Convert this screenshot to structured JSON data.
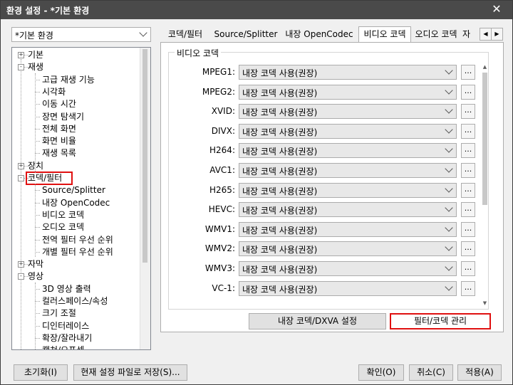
{
  "window": {
    "title": "환경 설정 - *기본 환경",
    "close_label": "✕"
  },
  "profile": {
    "selected": "*기본 환경"
  },
  "tree": [
    {
      "label": "기본",
      "level": 0,
      "expander": "+"
    },
    {
      "label": "재생",
      "level": 0,
      "expander": "-"
    },
    {
      "label": "고급 재생 기능",
      "level": 1
    },
    {
      "label": "시각화",
      "level": 1
    },
    {
      "label": "이동 시간",
      "level": 1
    },
    {
      "label": "장면 탐색기",
      "level": 1
    },
    {
      "label": "전체 화면",
      "level": 1
    },
    {
      "label": "화면 비율",
      "level": 1
    },
    {
      "label": "재생 목록",
      "level": 1
    },
    {
      "label": "장치",
      "level": 0,
      "expander": "+"
    },
    {
      "label": "코덱/필터",
      "level": 0,
      "expander": "-",
      "highlighted": true
    },
    {
      "label": "Source/Splitter",
      "level": 1
    },
    {
      "label": "내장 OpenCodec",
      "level": 1
    },
    {
      "label": "비디오 코덱",
      "level": 1
    },
    {
      "label": "오디오 코덱",
      "level": 1
    },
    {
      "label": "전역 필터 우선 순위",
      "level": 1
    },
    {
      "label": "개별 필터 우선 순위",
      "level": 1
    },
    {
      "label": "자막",
      "level": 0,
      "expander": "+"
    },
    {
      "label": "영상",
      "level": 0,
      "expander": "-"
    },
    {
      "label": "3D 영상 출력",
      "level": 1
    },
    {
      "label": "컬러스페이스/속성",
      "level": 1
    },
    {
      "label": "크기 조절",
      "level": 1
    },
    {
      "label": "디인터레이스",
      "level": 1
    },
    {
      "label": "확장/잘라내기",
      "level": 1
    },
    {
      "label": "캡쳐/오프셋",
      "level": 1
    }
  ],
  "tabs": [
    {
      "label": "코덱/필터"
    },
    {
      "label": "Source/Splitter"
    },
    {
      "label": "내장 OpenCodec"
    },
    {
      "label": "비디오 코덱",
      "active": true
    },
    {
      "label": "오디오 코덱"
    },
    {
      "label": "자"
    }
  ],
  "tab_arrows": {
    "left": "◀",
    "right": "▶"
  },
  "group": {
    "title": "비디오 코덱"
  },
  "codec_rows": [
    {
      "label": "MPEG1:",
      "value": "내장 코덱 사용(권장)"
    },
    {
      "label": "MPEG2:",
      "value": "내장 코덱 사용(권장)"
    },
    {
      "label": "XVID:",
      "value": "내장 코덱 사용(권장)"
    },
    {
      "label": "DIVX:",
      "value": "내장 코덱 사용(권장)"
    },
    {
      "label": "H264:",
      "value": "내장 코덱 사용(권장)"
    },
    {
      "label": "AVC1:",
      "value": "내장 코덱 사용(권장)"
    },
    {
      "label": "H265:",
      "value": "내장 코덱 사용(권장)"
    },
    {
      "label": "HEVC:",
      "value": "내장 코덱 사용(권장)"
    },
    {
      "label": "WMV1:",
      "value": "내장 코덱 사용(권장)"
    },
    {
      "label": "WMV2:",
      "value": "내장 코덱 사용(권장)"
    },
    {
      "label": "WMV3:",
      "value": "내장 코덱 사용(권장)"
    },
    {
      "label": "VC-1:",
      "value": "내장 코덱 사용(권장)"
    }
  ],
  "dots_label": "...",
  "panel_buttons": {
    "dxva": "내장 코덱/DXVA 설정",
    "filter_manage": "필터/코덱 관리"
  },
  "footer": {
    "reset": "초기화(I)",
    "save_preset": "현재 설정 파일로 저장(S)...",
    "ok": "확인(O)",
    "cancel": "취소(C)",
    "apply": "적용(A)"
  },
  "colors": {
    "titlebar": "#4a4a4a",
    "highlight_border": "#e01010"
  }
}
